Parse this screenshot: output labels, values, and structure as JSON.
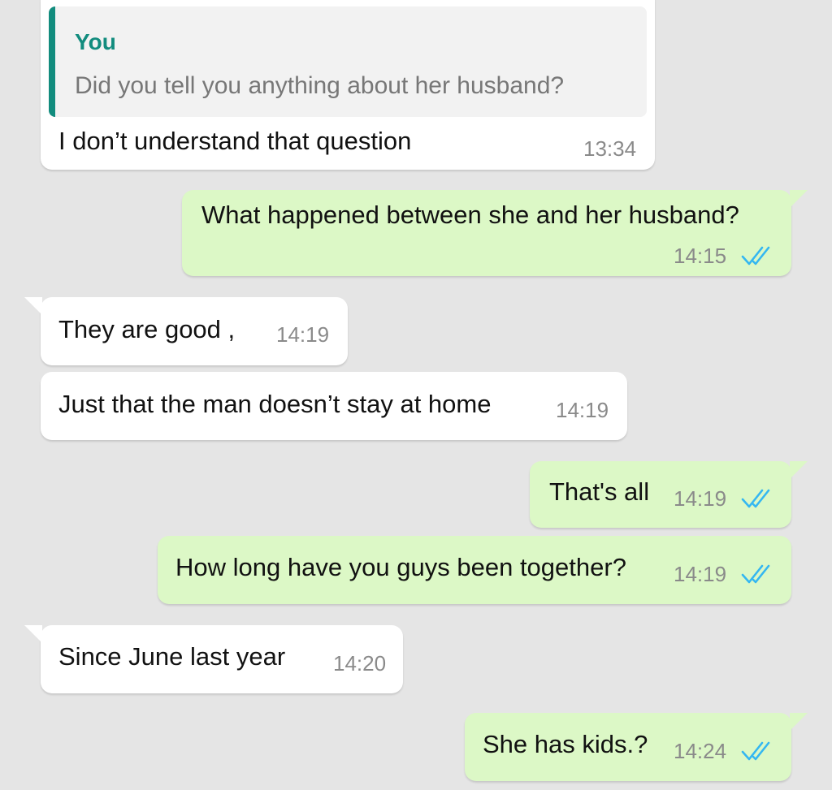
{
  "colors": {
    "background": "#e5e5e5",
    "incoming_bubble": "#ffffff",
    "outgoing_bubble": "#dcf8c6",
    "quote_accent": "#128c7e",
    "read_ticks": "#34b7f1",
    "timestamp": "#8a8a8a"
  },
  "messages": [
    {
      "direction": "incoming",
      "quote": {
        "author": "You",
        "text": "Did you tell you anything about her husband?"
      },
      "text": "I don’t understand that question",
      "time": "13:34"
    },
    {
      "direction": "outgoing",
      "text": "What happened between she and her husband?",
      "time": "14:15",
      "status_icon": "double-check-read-icon"
    },
    {
      "direction": "incoming",
      "text": "They are good ,",
      "time": "14:19"
    },
    {
      "direction": "incoming",
      "text": "Just that the man doesn’t stay at home",
      "time": "14:19"
    },
    {
      "direction": "outgoing",
      "text": "That's all",
      "time": "14:19",
      "status_icon": "double-check-read-icon"
    },
    {
      "direction": "outgoing",
      "text": "How long have you guys been together?",
      "time": "14:19",
      "status_icon": "double-check-read-icon"
    },
    {
      "direction": "incoming",
      "text": "Since June last year",
      "time": "14:20"
    },
    {
      "direction": "outgoing",
      "text": "She has kids.?",
      "time": "14:24",
      "status_icon": "double-check-read-icon"
    }
  ]
}
